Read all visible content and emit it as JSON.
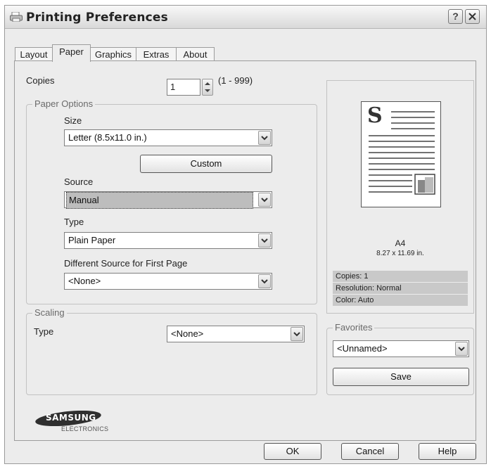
{
  "window": {
    "title": "Printing Preferences",
    "help_button": "?",
    "close_button": "X"
  },
  "tabs": [
    {
      "label": "Layout",
      "active": false
    },
    {
      "label": "Paper",
      "active": true
    },
    {
      "label": "Graphics",
      "active": false
    },
    {
      "label": "Extras",
      "active": false
    },
    {
      "label": "About",
      "active": false
    }
  ],
  "copies": {
    "label": "Copies",
    "value": "1",
    "range": "(1 - 999)"
  },
  "paper_options": {
    "legend": "Paper Options",
    "size_label": "Size",
    "size_value": "Letter (8.5x11.0 in.)",
    "custom_button": "Custom",
    "source_label": "Source",
    "source_value": "Manual",
    "type_label": "Type",
    "type_value": "Plain Paper",
    "first_page_label": "Different Source for First Page",
    "first_page_value": "<None>"
  },
  "scaling": {
    "legend": "Scaling",
    "type_label": "Type",
    "type_value": "<None>"
  },
  "preview": {
    "page_letter": "S",
    "paper_name": "A4",
    "paper_dims": "8.27 x 11.69 in.",
    "copies": "Copies: 1",
    "resolution": "Resolution: Normal",
    "color": "Color: Auto"
  },
  "favorites": {
    "legend": "Favorites",
    "value": "<Unnamed>",
    "save_button": "Save"
  },
  "logo": {
    "brand": "SAMSUNG",
    "sub": "ELECTRONICS"
  },
  "buttons": {
    "ok": "OK",
    "cancel": "Cancel",
    "help": "Help"
  }
}
